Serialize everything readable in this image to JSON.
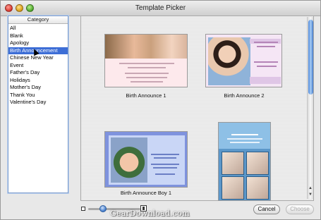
{
  "window": {
    "title": "Template Picker"
  },
  "sidebar": {
    "header": "Category",
    "items": [
      {
        "label": "All"
      },
      {
        "label": "Blank"
      },
      {
        "label": "Apology"
      },
      {
        "label": "Birth Announcement"
      },
      {
        "label": "Chinese New Year"
      },
      {
        "label": "Event"
      },
      {
        "label": "Father's Day"
      },
      {
        "label": "Holidays"
      },
      {
        "label": "Mother's Day"
      },
      {
        "label": "Thank You"
      },
      {
        "label": "Valentine's Day"
      }
    ],
    "selected": "Birth Announcement"
  },
  "templates": [
    {
      "label": "Birth Announce 1"
    },
    {
      "label": "Birth Announce 2"
    },
    {
      "label": "Birth Announce Boy 1"
    },
    {
      "label": ""
    }
  ],
  "footer": {
    "cancel_label": "Cancel",
    "choose_label": "Choose",
    "watermark": "GearDownload.com"
  },
  "colors": {
    "selection": "#3d6ed6",
    "scroll_thumb": "#4c86d8"
  },
  "icons": {
    "zoom_out": "small-square-icon",
    "zoom_in": "large-square-icon"
  }
}
